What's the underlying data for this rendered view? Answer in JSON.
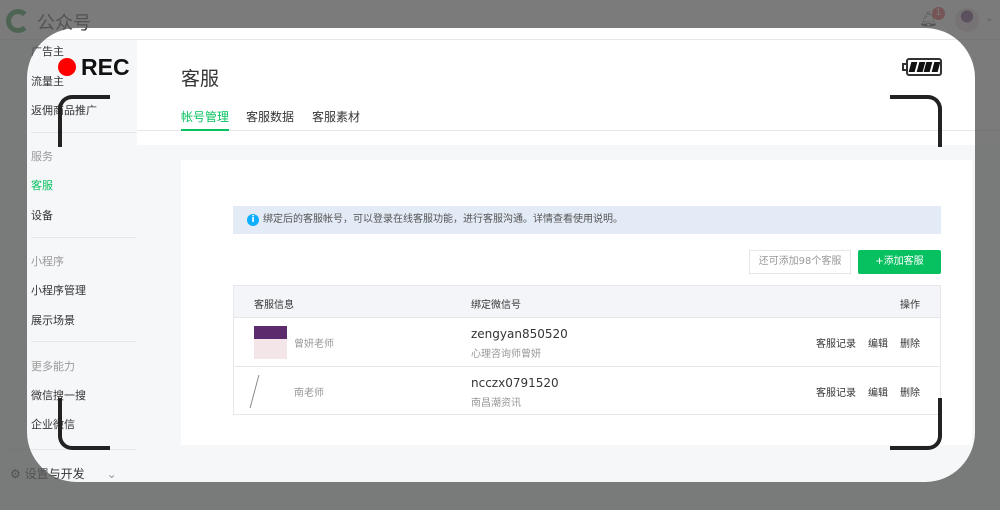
{
  "header": {
    "brand": "公众号",
    "notification_count": "1"
  },
  "sidebar": {
    "items": [
      {
        "label": "广告主",
        "type": "item"
      },
      {
        "label": "流量主",
        "type": "item"
      },
      {
        "label": "返佣商品推广",
        "type": "item"
      },
      {
        "label": "服务",
        "type": "group"
      },
      {
        "label": "客服",
        "type": "item",
        "active": true
      },
      {
        "label": "设备",
        "type": "item"
      },
      {
        "label": "小程序",
        "type": "group"
      },
      {
        "label": "小程序管理",
        "type": "item"
      },
      {
        "label": "展示场景",
        "type": "item"
      },
      {
        "label": "更多能力",
        "type": "group"
      },
      {
        "label": "微信搜一搜",
        "type": "item"
      },
      {
        "label": "企业微信",
        "type": "item"
      }
    ],
    "settings": "设置与开发"
  },
  "main": {
    "title": "客服",
    "tabs": [
      {
        "label": "帐号管理",
        "active": true
      },
      {
        "label": "客服数据"
      },
      {
        "label": "客服素材"
      }
    ],
    "notice": "绑定后的客服帐号，可以登录在线客服功能，进行客服沟通。详情查看使用说明。",
    "remaining": "还可添加98个客服",
    "add_button": "+添加客服",
    "table": {
      "headers": [
        "客服信息",
        "绑定微信号",
        "操作"
      ],
      "rows": [
        {
          "name": "曾妍老师",
          "wechat_id": "zengyan850520",
          "wechat_name": "心理咨询师曾妍",
          "actions": [
            "客服记录",
            "编辑",
            "删除"
          ]
        },
        {
          "name": "南老师",
          "wechat_id": "ncczx0791520",
          "wechat_name": "南昌潮资讯",
          "actions": [
            "客服记录",
            "编辑",
            "删除"
          ]
        }
      ]
    }
  },
  "overlay": {
    "rec_label": "REC",
    "battery_level": 1.0
  },
  "colors": {
    "accent": "#07c160",
    "rec": "#ff0000",
    "notice_bg": "#e3ebf6"
  }
}
